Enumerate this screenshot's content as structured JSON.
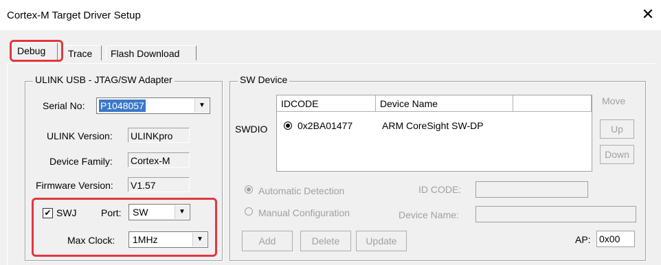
{
  "window": {
    "title": "Cortex-M Target Driver Setup",
    "close_glyph": "✕"
  },
  "tabs": [
    {
      "label": "Debug",
      "active": true
    },
    {
      "label": "Trace",
      "active": false
    },
    {
      "label": "Flash Download",
      "active": false
    }
  ],
  "adapter": {
    "legend": "ULINK USB - JTAG/SW Adapter",
    "serial_label": "Serial No:",
    "serial_value": "P1048057",
    "version_label": "ULINK Version:",
    "version_value": "ULINKpro",
    "family_label": "Device Family:",
    "family_value": "Cortex-M",
    "firmware_label": "Firmware Version:",
    "firmware_value": "V1.57",
    "swj_label": "SWJ",
    "swj_checked": true,
    "port_label": "Port:",
    "port_value": "SW",
    "clock_label": "Max Clock:",
    "clock_value": "1MHz"
  },
  "sw_device": {
    "legend": "SW Device",
    "swdio_label": "SWDIO",
    "columns": [
      "IDCODE",
      "Device Name"
    ],
    "rows": [
      {
        "idcode": "0x2BA01477",
        "name": "ARM CoreSight SW-DP"
      }
    ],
    "move_label": "Move",
    "up_label": "Up",
    "down_label": "Down",
    "auto_label": "Automatic Detection",
    "manual_label": "Manual Configuration",
    "idcode_label": "ID CODE:",
    "devname_label": "Device Name:",
    "add_label": "Add",
    "delete_label": "Delete",
    "update_label": "Update",
    "ap_label": "AP:",
    "ap_value": "0x00"
  },
  "colors": {
    "highlight": "#e0383d",
    "selection": "#3b78c8",
    "dialog_bg": "#f0f0f0"
  }
}
